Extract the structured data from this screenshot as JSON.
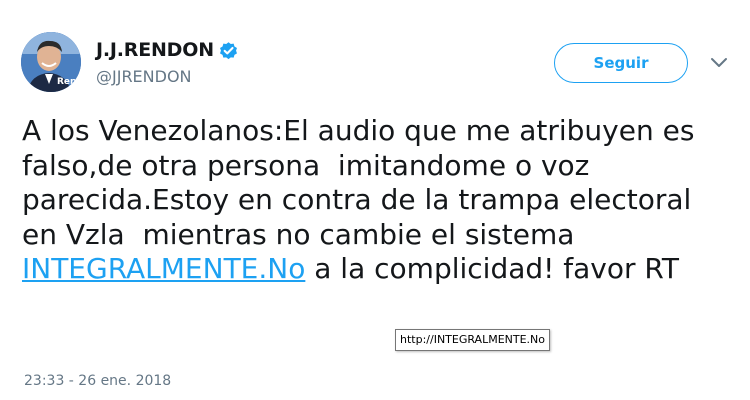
{
  "author": {
    "display_name": "J.J.RENDON",
    "handle": "@JJRENDON",
    "verified": true,
    "avatar_icon": "profile-photo",
    "avatar_overlay_text": "Rendon"
  },
  "follow_button": {
    "label": "Seguir"
  },
  "menu": {
    "icon": "chevron-down-icon"
  },
  "tweet": {
    "text_before_link": "A los Venezolanos:El audio que me atribuyen es falso,de otra persona  imitandome o voz parecida.Estoy en contra de la trampa electoral en Vzla  mientras no cambie el sistema ",
    "link_text": "INTEGRALMENTE.No",
    "text_after_link": " a la complicidad! favor RT",
    "link_tooltip": "http://INTEGRALMENTE.No"
  },
  "timestamp": "23:33 - 26 ene. 2018",
  "colors": {
    "accent": "#1da1f2",
    "text": "#14171a",
    "secondary_text": "#657786"
  }
}
